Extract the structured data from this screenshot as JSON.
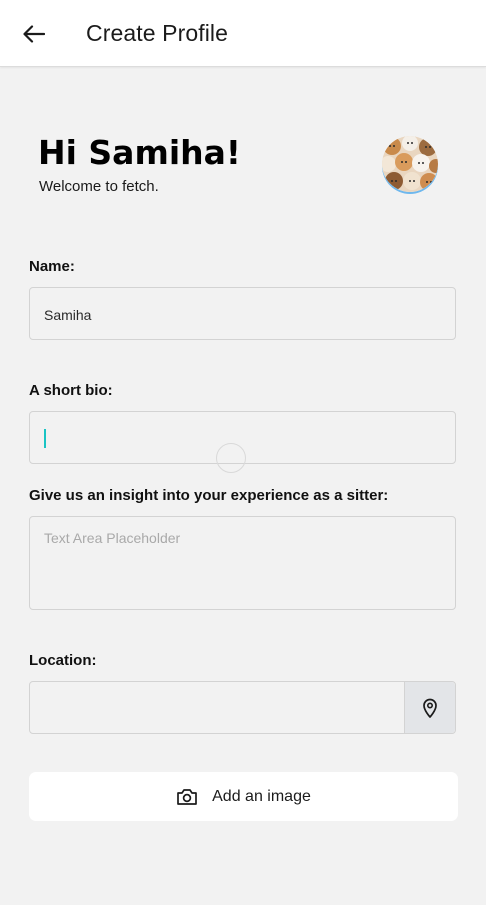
{
  "header": {
    "title": "Create Profile",
    "back_icon": "arrow-left-icon"
  },
  "greeting": {
    "title": "Hi Samiha!",
    "subtitle": "Welcome to fetch."
  },
  "avatar": {
    "icon": "profile-photo-cats"
  },
  "form": {
    "name": {
      "label": "Name:",
      "value": "Samiha"
    },
    "bio": {
      "label": "A short bio:",
      "value": ""
    },
    "experience": {
      "label": "Give us an insight into your experience as a sitter:",
      "placeholder": "Text Area Placeholder"
    },
    "location": {
      "label": "Location:",
      "value": "",
      "icon": "location-pin-icon"
    }
  },
  "add_image": {
    "label": "Add an image",
    "icon": "camera-icon"
  },
  "colors": {
    "background": "#f2f2f2",
    "appbar": "#ffffff",
    "cursor": "#19c4c4",
    "field_border": "#d3d3d3"
  }
}
